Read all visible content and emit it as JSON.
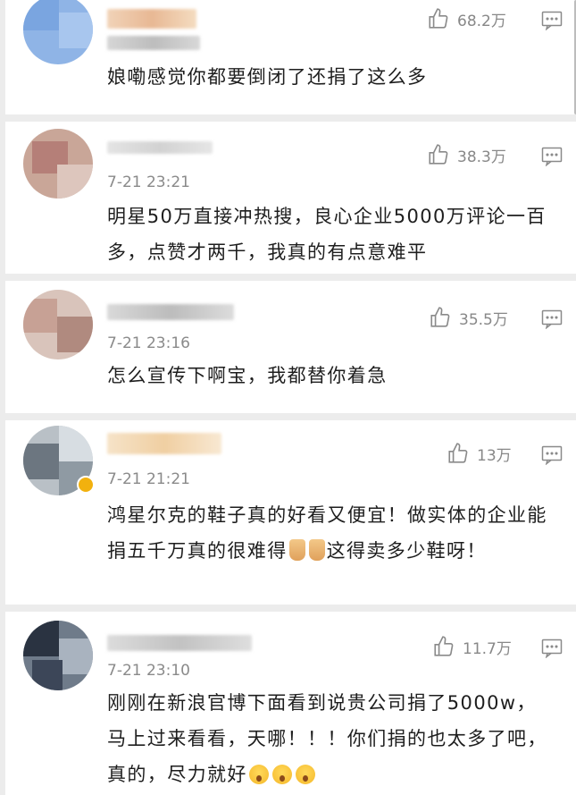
{
  "comments": [
    {
      "time": "",
      "likes": "68.2万",
      "text": "娘嘞感觉你都要倒闭了还捐了这么多"
    },
    {
      "time": "7-21 23:21",
      "likes": "38.3万",
      "text": "明星50万直接冲热搜，良心企业5000万评论一百多，点赞才两千，我真的有点意难平"
    },
    {
      "time": "7-21 23:16",
      "likes": "35.5万",
      "text": "怎么宣传下啊宝，我都替你着急"
    },
    {
      "time": "7-21 21:21",
      "likes": "13万",
      "text_a": "鸿星尔克的鞋子真的好看又便宜！做实体的企业能捐五千万真的很难得",
      "text_b": "这得卖多少鞋呀！"
    },
    {
      "time": "7-21 23:10",
      "likes": "11.7万",
      "text": "刚刚在新浪官博下面看到说贵公司捐了5000w，马上过来看看，天哪！！！你们捐的也太多了吧，真的，尽力就好"
    }
  ],
  "icons": {
    "like": "thumbs-up-icon",
    "reply": "comment-icon",
    "verified": "verified-badge-icon"
  }
}
